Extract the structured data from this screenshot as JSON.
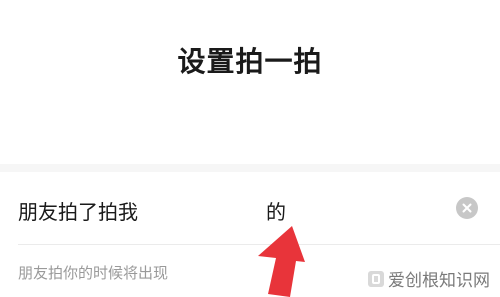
{
  "header": {
    "title": "设置拍一拍"
  },
  "pat_input": {
    "prefix": "朋友拍了拍我",
    "value": "的",
    "clear_icon": "clear-circle-icon"
  },
  "hint": "朋友拍你的时候将出现",
  "annotation": {
    "icon": "red-arrow-icon",
    "color": "#e8343a"
  },
  "watermark": {
    "text": "爱创根知识网",
    "icon": "site-logo-icon"
  }
}
